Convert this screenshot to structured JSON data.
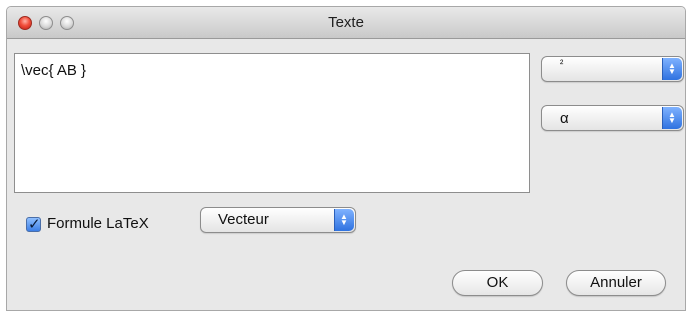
{
  "window": {
    "title": "Texte"
  },
  "editor": {
    "content": "\\vec{ AB }"
  },
  "superscript_popup": {
    "selected": "²"
  },
  "greek_popup": {
    "selected": "α"
  },
  "latex_checkbox": {
    "label": "Formule LaTeX",
    "checked": true
  },
  "type_popup": {
    "selected": "Vecteur"
  },
  "buttons": {
    "ok": "OK",
    "cancel": "Annuler"
  },
  "icons": {
    "close": "close-icon",
    "minimize": "minimize-icon",
    "zoom": "zoom-icon",
    "popup_arrows": "up-down-arrows-icon",
    "check": "checkmark-icon"
  },
  "colors": {
    "accent": "#3c7fe6",
    "close_button": "#f2503d"
  }
}
